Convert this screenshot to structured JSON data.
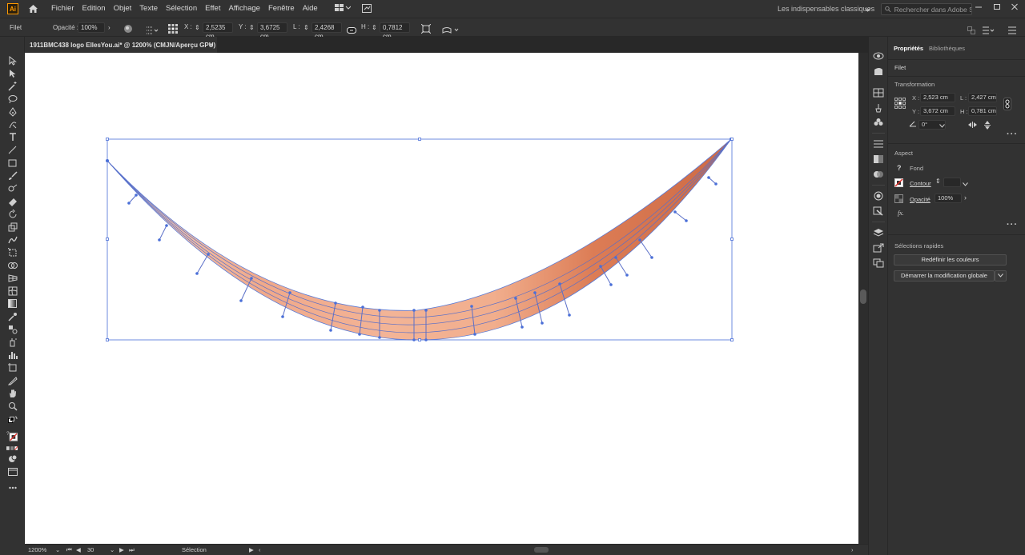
{
  "app": {
    "logo": "Ai"
  },
  "menu": [
    "Fichier",
    "Edition",
    "Objet",
    "Texte",
    "Sélection",
    "Effet",
    "Affichage",
    "Fenêtre",
    "Aide"
  ],
  "workspace": {
    "label": "Les indispensables classiques"
  },
  "search": {
    "placeholder": "Rechercher dans Adobe Stock"
  },
  "control": {
    "object_type": "Filet",
    "opacity_label": "Opacité :",
    "opacity_value": "100%",
    "x_label": "X :",
    "x_value": "2,5235 cm",
    "y_label": "Y :",
    "y_value": "3,6725 cm",
    "w_label": "L :",
    "w_value": "2,4268 cm",
    "h_label": "H :",
    "h_value": "0,7812 cm"
  },
  "document": {
    "tab_title": "1911BMC438 logo EllesYou.ai* @ 1200% (CMJN/Aperçu GPU)",
    "close": "×"
  },
  "status": {
    "zoom": "1200%",
    "artboard": "30",
    "tool": "Sélection"
  },
  "properties": {
    "tabs": [
      "Propriétés",
      "Bibliothèques"
    ],
    "object_type": "Filet",
    "transform_title": "Transformation",
    "x_label": "X :",
    "x_value": "2,523 cm",
    "y_label": "Y :",
    "y_value": "3,672 cm",
    "w_label": "L :",
    "w_value": "2,427 cm",
    "h_label": "H :",
    "h_value": "0,781 cm",
    "angle_value": "0°",
    "aspect_title": "Aspect",
    "fill_label": "Fond",
    "stroke_label": "Contour",
    "opacity_label": "Opacité",
    "opacity_value": "100%",
    "fx": "fx.",
    "quick_title": "Sélections rapides",
    "recolor_button": "Redéfinir les couleurs",
    "global_edit_button": "Démarrer la modification globale"
  },
  "colors": {
    "ui_dark": "#323232",
    "accent_orange": "#ff9a00",
    "selection_blue": "#4a6fd8",
    "mesh_light": "#f6c7aa",
    "mesh_dark": "#d4714a"
  }
}
